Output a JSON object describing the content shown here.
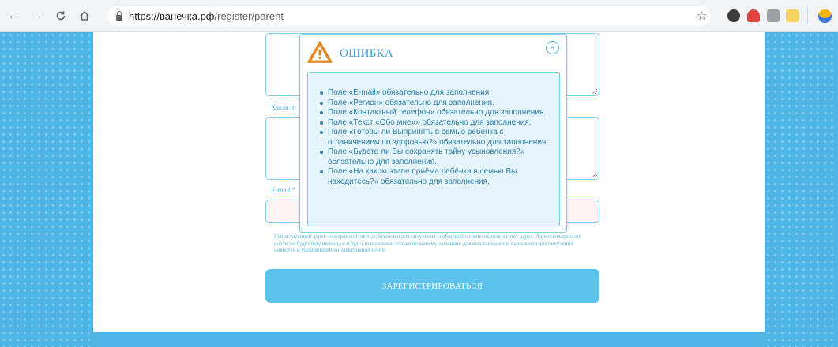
{
  "browser": {
    "url_host": "https://ванечка.рф",
    "url_path": "/register/parent"
  },
  "form": {
    "question_label_partial": "Какая п",
    "email_label": "E-mail *",
    "notice_text": "Существующий адрес электронной почты обязателен для получения сообщений о смене пароля на этот адрес. Адрес электронной почты не будет публиковаться и будет использован только по вашему желанию: для восстановления пароля или для получения новостей и уведомлений по электронной почте.",
    "register_button": "ЗАРЕГИСТРИРОВАТЬСЯ"
  },
  "modal": {
    "title": "ОШИБКА",
    "errors": [
      "Поле «E-mail» обязательно для заполнения.",
      "Поле «Регион» обязательно для заполнения.",
      "Поле «Контактный телефон» обязательно для заполнения.",
      "Поле «Текст «Обо мне»» обязательно для заполнения.",
      "Поле «Готовы ли Выпринять в семью ребёнка с ограничением по здоровью?» обязательно для заполнения.",
      "Поле «Будете ли Вы сохранять тайну усыновления?» обязательно для заполнения.",
      "Поле «На каком этапе приёма ребёнка в семью Вы находитесь?» обязательно для заполнения."
    ]
  },
  "colors": {
    "accent": "#4fb4e6",
    "button": "#5dc3ed",
    "warning": "#f08a24",
    "error_text": "#2e7fa8"
  },
  "icons": [
    "back-arrow-icon",
    "forward-arrow-icon",
    "reload-icon",
    "home-icon",
    "lock-icon",
    "star-icon",
    "warning-icon",
    "close-icon"
  ]
}
